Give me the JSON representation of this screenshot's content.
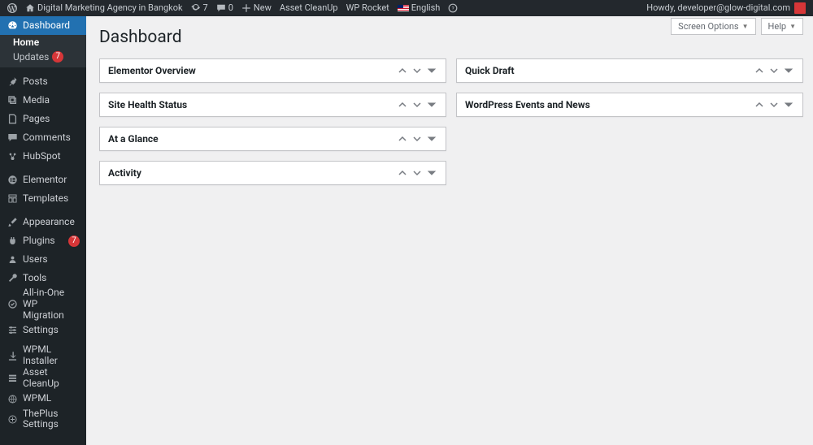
{
  "adminbar": {
    "site_title": "Digital Marketing Agency in Bangkok",
    "updates_count": "7",
    "comments_count": "0",
    "new_label": "New",
    "asset_cleanup": "Asset CleanUp",
    "wp_rocket": "WP Rocket",
    "language_label": "English",
    "howdy": "Howdy, developer@glow-digital.com",
    "avatar_initials": ""
  },
  "header": {
    "screen_options": "Screen Options",
    "help": "Help"
  },
  "page_title": "Dashboard",
  "sidebar": {
    "dashboard": "Dashboard",
    "home": "Home",
    "updates": "Updates",
    "updates_badge": "7",
    "posts": "Posts",
    "media": "Media",
    "pages": "Pages",
    "comments": "Comments",
    "hubspot": "HubSpot",
    "elementor": "Elementor",
    "templates": "Templates",
    "appearance": "Appearance",
    "plugins": "Plugins",
    "plugins_badge": "7",
    "users": "Users",
    "tools": "Tools",
    "aio_migration": "All-in-One WP Migration",
    "settings": "Settings",
    "wpml_installer": "WPML Installer",
    "asset_cleanup": "Asset CleanUp",
    "wpml": "WPML",
    "theplus": "ThePlus Settings"
  },
  "metaboxes": {
    "left": [
      {
        "title": "Elementor Overview"
      },
      {
        "title": "Site Health Status"
      },
      {
        "title": "At a Glance"
      },
      {
        "title": "Activity"
      }
    ],
    "right": [
      {
        "title": "Quick Draft"
      },
      {
        "title": "WordPress Events and News"
      }
    ]
  }
}
